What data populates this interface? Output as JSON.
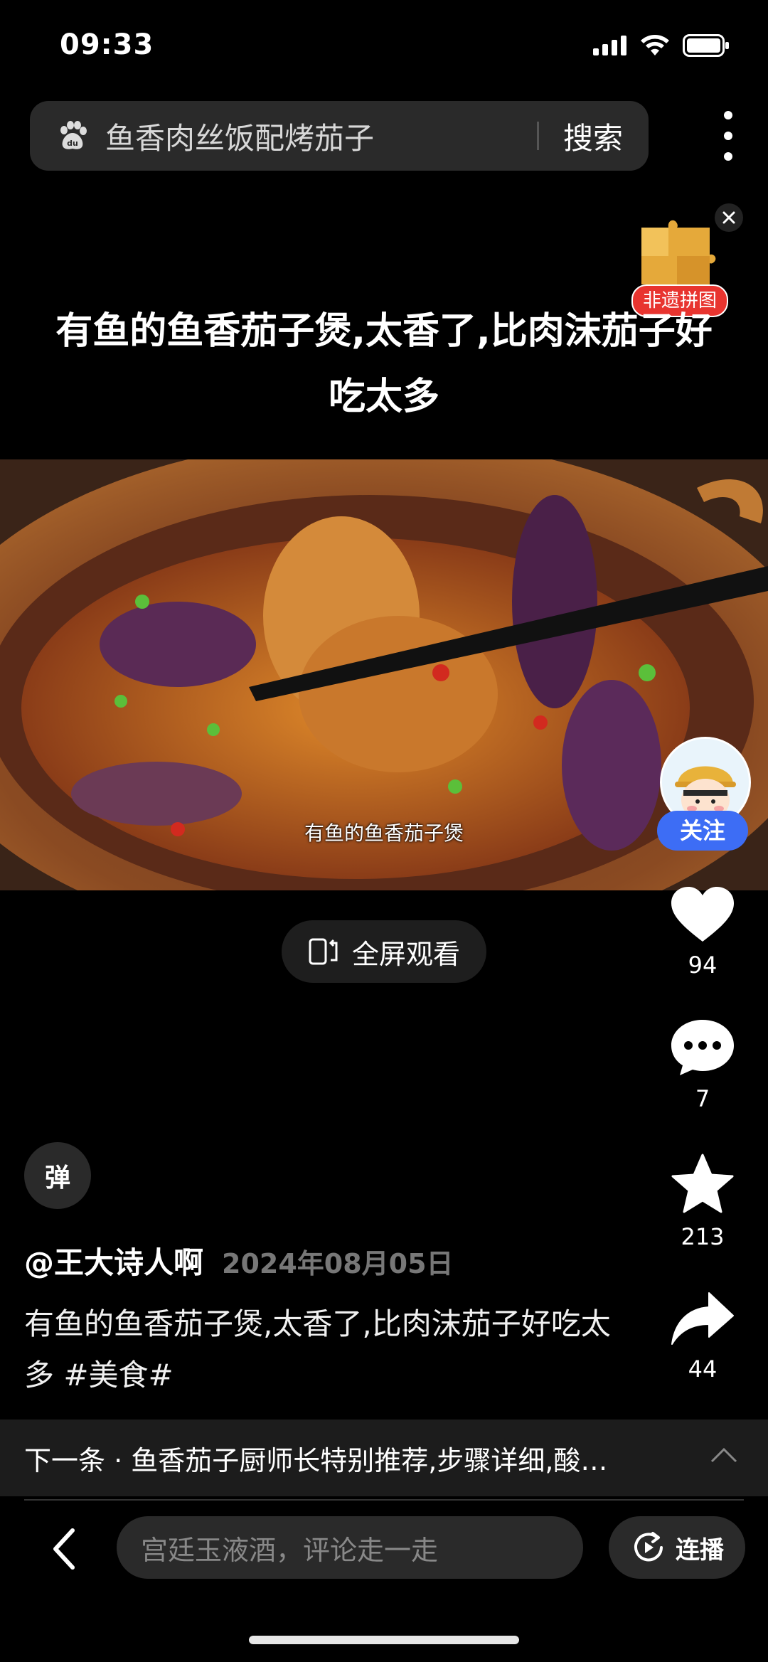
{
  "status": {
    "time": "09:33"
  },
  "search": {
    "query": "鱼香肉丝饭配烤茄子",
    "button": "搜索"
  },
  "badge": {
    "label": "非遗拼图"
  },
  "video": {
    "title": "有鱼的鱼香茄子煲,太香了,比肉沫茄子好吃太多",
    "subtitle": "有鱼的鱼香茄子煲",
    "fullscreen_label": "全屏观看"
  },
  "follow": {
    "label": "关注"
  },
  "actions": {
    "likes": "94",
    "comments": "7",
    "favorites": "213",
    "shares": "44"
  },
  "danmaku": {
    "label": "弹"
  },
  "post": {
    "author": "@王大诗人啊",
    "date": "2024年08月05日",
    "description": "有鱼的鱼香茄子煲,太香了,比肉沫茄子好吃太多 #美食#"
  },
  "next": {
    "text": "下一条 · 鱼香茄子厨师长特别推荐,步骤详细,酸…"
  },
  "bottom": {
    "comment_placeholder": "宫廷玉液酒，评论走一走",
    "autoplay_label": "连播"
  }
}
